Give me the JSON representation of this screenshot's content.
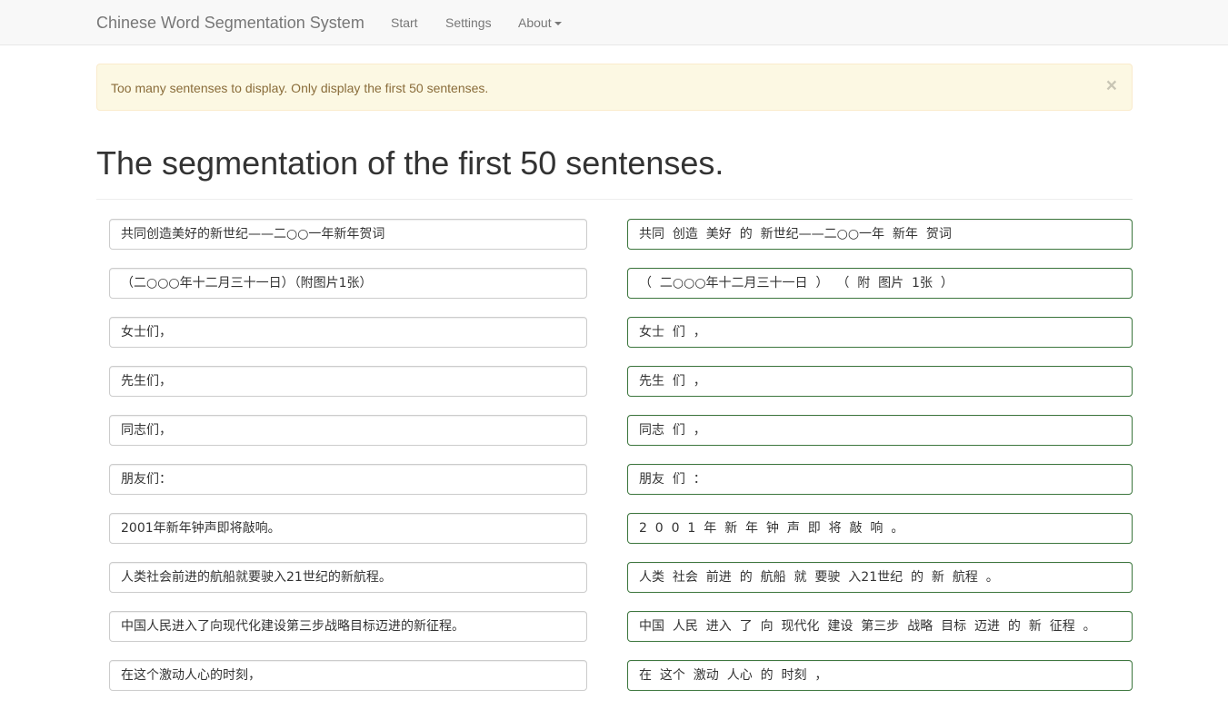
{
  "navbar": {
    "brand": "Chinese Word Segmentation System",
    "items": [
      {
        "label": "Start"
      },
      {
        "label": "Settings"
      },
      {
        "label": "About"
      }
    ]
  },
  "alert": {
    "message": "Too many sentenses to display. Only display the first 50 sentenses.",
    "close_glyph": "×"
  },
  "page": {
    "title": "The segmentation of the first 50 sentenses."
  },
  "rows": [
    {
      "source": "共同创造美好的新世纪——二○○一年新年贺词",
      "segmented": "共同  创造  美好  的  新世纪——二○○一年  新年  贺词"
    },
    {
      "source": "（二○○○年十二月三十一日）（附图片1张）",
      "segmented": "（  二○○○年十二月三十一日  ）  （  附  图片  1张  ）"
    },
    {
      "source": "女士们，",
      "segmented": "女士  们  ，"
    },
    {
      "source": "先生们，",
      "segmented": "先生  们  ，"
    },
    {
      "source": "同志们，",
      "segmented": "同志  们  ，"
    },
    {
      "source": "朋友们：",
      "segmented": "朋友  们  ："
    },
    {
      "source": "2001年新年钟声即将敲响。",
      "segmented": "2  0  0  1  年  新  年  钟  声  即  将  敲  响  。"
    },
    {
      "source": "人类社会前进的航船就要驶入21世纪的新航程。",
      "segmented": "人类  社会  前进  的  航船  就  要驶  入21世纪  的  新  航程  。"
    },
    {
      "source": "中国人民进入了向现代化建设第三步战略目标迈进的新征程。",
      "segmented": "中国  人民  进入  了  向  现代化  建设  第三步  战略  目标  迈进  的  新  征程  。"
    },
    {
      "source": "在这个激动人心的时刻，",
      "segmented": "在  这个  激动  人心  的  时刻  ，"
    }
  ]
}
